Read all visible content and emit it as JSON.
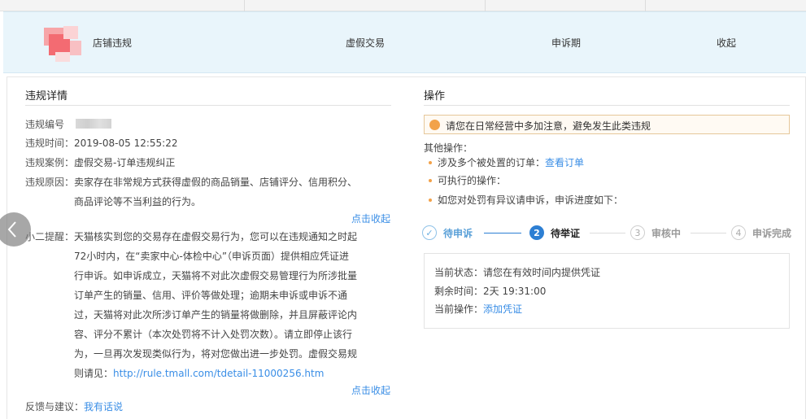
{
  "summary": {
    "type": "店铺违规",
    "category": "虚假交易",
    "period": "申诉期",
    "collapse": "收起"
  },
  "details": {
    "title": "违规详情",
    "number_label": "违规编号",
    "time_label": "违规时间：",
    "time_value": "2019-08-05 12:55:22",
    "case_label": "违规案例：",
    "case_value": "虚假交易-订单违规纠正",
    "reason_label": "违规原因：",
    "reason_line1": "卖家存在非常规方式获得虚假的商品销量、店铺评分、信用积分、",
    "reason_line2": "商品评论等不当利益的行为。",
    "collapse1": "点击收起",
    "reminder_label": "小二提醒：",
    "reminder_lines": [
      "天猫核实到您的交易存在虚假交易行为，您可以在违规通知之时起",
      "72小时内，在“卖家中心-体检中心”（申诉页面）提供相应凭证进",
      "行申诉。如申诉成立，天猫将不对此次虚假交易管理行为所涉批量",
      "订单产生的销量、信用、评价等做处理；逾期未申诉或申诉不通",
      "过，天猫将对此次所涉订单产生的销量将做删除，并且屏蔽评论内",
      "容、评分不累计（本次处罚将不计入处罚次数）。请立即停止该行",
      "为，一旦再次发现类似行为，将对您做出进一步处罚。虚假交易规"
    ],
    "rule_prefix": "则请见：",
    "rule_link": "http://rule.tmall.com/tdetail-11000256.htm",
    "collapse2": "点击收起",
    "feedback_label": "反馈与建议：",
    "feedback_link": "我有话说"
  },
  "operations": {
    "title": "操作",
    "notice": "请您在日常经营中多加注意，避免发生此类违规",
    "other_label": "其他操作：",
    "item1_text": "涉及多个被处置的订单：",
    "item1_link": "查看订单",
    "item2_text": "可执行的操作：",
    "item3_text": "如您对处罚有异议请申诉，申诉进度如下：",
    "steps": [
      {
        "num": "✓",
        "label": "待申诉",
        "state": "done"
      },
      {
        "num": "2",
        "label": "待举证",
        "state": "current"
      },
      {
        "num": "3",
        "label": "审核中",
        "state": "todo"
      },
      {
        "num": "4",
        "label": "申诉完成",
        "state": "todo"
      }
    ],
    "status_label": "当前状态：",
    "status_value": "请您在有效时间内提供凭证",
    "remain_label": "剩余时间：",
    "remain_value": "2天 19:31:00",
    "action_label": "当前操作：",
    "action_link": "添加凭证"
  },
  "colors": {
    "accent": "#2d7fd3",
    "link": "#3a8ee6",
    "warning_dot": "#f2a24a",
    "summary_bg": "#e9f5fb"
  }
}
